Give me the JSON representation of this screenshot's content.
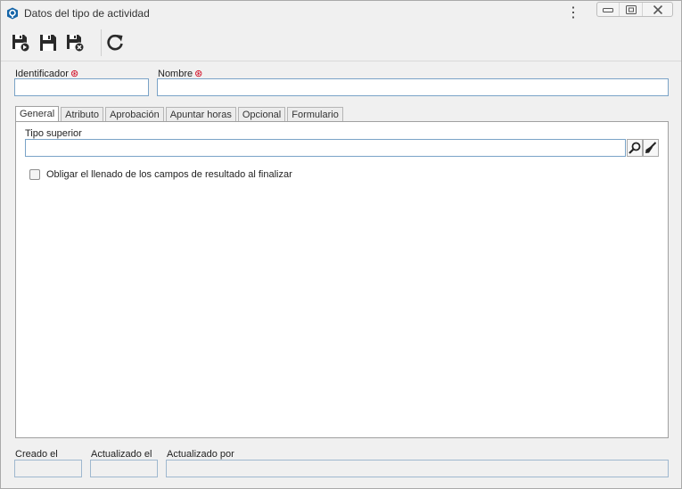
{
  "window": {
    "title": "Datos del tipo de actividad",
    "menu_glyph": "⋮"
  },
  "toolbar": {
    "buttons": [
      {
        "name": "save-and-new",
        "icon": "floppy-arrow-icon"
      },
      {
        "name": "save",
        "icon": "floppy-icon"
      },
      {
        "name": "save-and-close",
        "icon": "floppy-x-icon"
      },
      {
        "name": "refresh",
        "icon": "refresh-icon"
      }
    ]
  },
  "form": {
    "identifier_label": "Identificador",
    "identifier_value": "",
    "name_label": "Nombre",
    "name_value": "",
    "required_glyph": "⊛"
  },
  "tabs": [
    {
      "label": "General",
      "active": true
    },
    {
      "label": "Atributo",
      "active": false
    },
    {
      "label": "Aprobación",
      "active": false
    },
    {
      "label": "Apuntar horas",
      "active": false
    },
    {
      "label": "Opcional",
      "active": false
    },
    {
      "label": "Formulario",
      "active": false
    }
  ],
  "general": {
    "parent_type_label": "Tipo superior",
    "parent_type_value": "",
    "checkbox_label": "Obligar el llenado de los campos de resultado al finalizar",
    "checkbox_checked": false
  },
  "footer": {
    "created_label": "Creado el",
    "updated_label": "Actualizado el",
    "updated_by_label": "Actualizado por",
    "created_value": "",
    "updated_value": "",
    "updated_by_value": ""
  },
  "colors": {
    "accent": "#1565a8",
    "required": "#d0021b",
    "input_border": "#7aa3c7"
  }
}
